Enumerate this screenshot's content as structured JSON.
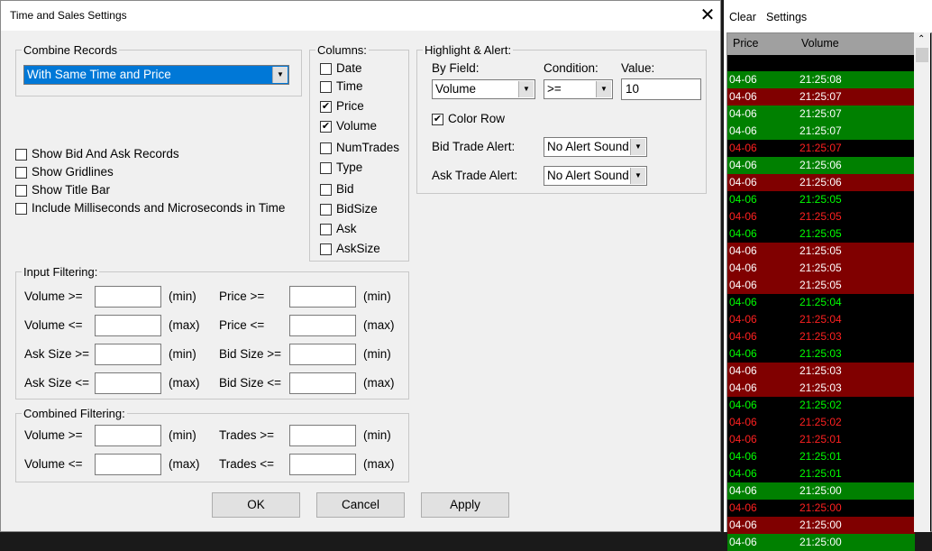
{
  "dialog": {
    "title": "Time and Sales Settings",
    "combine": {
      "legend": "Combine Records",
      "value": "With Same Time and Price"
    },
    "options": [
      {
        "label": "Show Bid And Ask Records",
        "checked": false
      },
      {
        "label": "Show Gridlines",
        "checked": false
      },
      {
        "label": "Show Title Bar",
        "checked": false
      },
      {
        "label": "Include Milliseconds and Microseconds in Time",
        "checked": false
      }
    ],
    "columns": {
      "legend": "Columns:",
      "items": [
        {
          "label": "Date",
          "checked": false
        },
        {
          "label": "Time",
          "checked": false
        },
        {
          "label": "Price",
          "checked": true
        },
        {
          "label": "Volume",
          "checked": true
        },
        {
          "label": "NumTrades",
          "checked": false
        },
        {
          "label": "Type",
          "checked": false
        },
        {
          "label": "Bid",
          "checked": false
        },
        {
          "label": "BidSize",
          "checked": false
        },
        {
          "label": "Ask",
          "checked": false
        },
        {
          "label": "AskSize",
          "checked": false
        }
      ]
    },
    "highlight": {
      "legend": "Highlight & Alert:",
      "by_field_label": "By Field:",
      "by_field": "Volume",
      "condition_label": "Condition:",
      "condition": ">=",
      "value_label": "Value:",
      "value": "10",
      "color_row": "Color Row",
      "bid_alert_label": "Bid Trade Alert:",
      "bid_alert": "No Alert Sound",
      "ask_alert_label": "Ask Trade Alert:",
      "ask_alert": "No Alert Sound"
    },
    "input_filtering": {
      "legend": "Input Filtering:",
      "rows": [
        {
          "l1": "Volume >=",
          "u1": "(min)",
          "l2": "Price >=",
          "u2": "(min)"
        },
        {
          "l1": "Volume <=",
          "u1": "(max)",
          "l2": "Price <=",
          "u2": "(max)"
        },
        {
          "l1": "Ask Size >=",
          "u1": "(min)",
          "l2": "Bid Size >=",
          "u2": "(min)"
        },
        {
          "l1": "Ask Size <=",
          "u1": "(max)",
          "l2": "Bid Size <=",
          "u2": "(max)"
        }
      ]
    },
    "combined_filtering": {
      "legend": "Combined Filtering:",
      "rows": [
        {
          "l1": "Volume >=",
          "u1": "(min)",
          "l2": "Trades >=",
          "u2": "(min)"
        },
        {
          "l1": "Volume <=",
          "u1": "(max)",
          "l2": "Trades <=",
          "u2": "(max)"
        }
      ]
    },
    "buttons": {
      "ok": "OK",
      "cancel": "Cancel",
      "apply": "Apply"
    }
  },
  "panel": {
    "menu": [
      "Clear",
      "Settings"
    ],
    "headers": [
      "Price",
      "Volume"
    ],
    "colors": {
      "green": "#008000",
      "darkred": "#800000",
      "black": "#000000",
      "bright_green": "#00ff00",
      "bright_red": "#ff2020"
    },
    "rows": [
      [
        "04-06",
        "21:25:08",
        "G"
      ],
      [
        "04-06",
        "21:25:07",
        "R"
      ],
      [
        "04-06",
        "21:25:07",
        "G"
      ],
      [
        "04-06",
        "21:25:07",
        "G"
      ],
      [
        "04-06",
        "21:25:07",
        "r"
      ],
      [
        "04-06",
        "21:25:06",
        "G"
      ],
      [
        "04-06",
        "21:25:06",
        "R"
      ],
      [
        "04-06",
        "21:25:05",
        "g"
      ],
      [
        "04-06",
        "21:25:05",
        "r"
      ],
      [
        "04-06",
        "21:25:05",
        "g"
      ],
      [
        "04-06",
        "21:25:05",
        "R"
      ],
      [
        "04-06",
        "21:25:05",
        "R"
      ],
      [
        "04-06",
        "21:25:05",
        "R"
      ],
      [
        "04-06",
        "21:25:04",
        "g"
      ],
      [
        "04-06",
        "21:25:04",
        "r"
      ],
      [
        "04-06",
        "21:25:03",
        "r"
      ],
      [
        "04-06",
        "21:25:03",
        "g"
      ],
      [
        "04-06",
        "21:25:03",
        "R"
      ],
      [
        "04-06",
        "21:25:03",
        "R"
      ],
      [
        "04-06",
        "21:25:02",
        "g"
      ],
      [
        "04-06",
        "21:25:02",
        "r"
      ],
      [
        "04-06",
        "21:25:01",
        "r"
      ],
      [
        "04-06",
        "21:25:01",
        "g"
      ],
      [
        "04-06",
        "21:25:01",
        "g"
      ],
      [
        "04-06",
        "21:25:00",
        "G"
      ],
      [
        "04-06",
        "21:25:00",
        "r"
      ],
      [
        "04-06",
        "21:25:00",
        "R"
      ],
      [
        "04-06",
        "21:25:00",
        "G"
      ]
    ]
  }
}
